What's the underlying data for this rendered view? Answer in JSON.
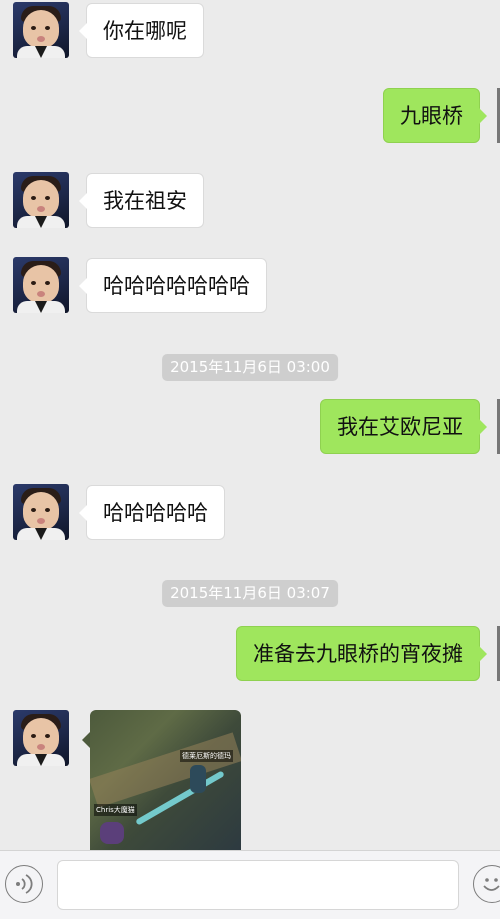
{
  "messages": [
    {
      "side": "in",
      "text": "你在哪呢"
    },
    {
      "side": "out",
      "text": "九眼桥"
    },
    {
      "side": "in",
      "text": "我在祖安"
    },
    {
      "side": "in",
      "text": "哈哈哈哈哈哈哈"
    },
    {
      "side": "time",
      "text": "2015年11月6日 03:00"
    },
    {
      "side": "out",
      "text": "我在艾欧尼亚"
    },
    {
      "side": "in",
      "text": "哈哈哈哈哈"
    },
    {
      "side": "time",
      "text": "2015年11月6日 03:07"
    },
    {
      "side": "out",
      "text": "准备去九眼桥的宵夜摊"
    },
    {
      "side": "in",
      "type": "image",
      "image_labels": [
        "德莱厄斯的德玛",
        "Chris大魔猫"
      ]
    }
  ],
  "input_bar": {
    "voice_icon": "voice-icon",
    "emoji_icon": "emoji-icon",
    "text_value": ""
  },
  "colors": {
    "background": "#ebebeb",
    "incoming_bubble": "#ffffff",
    "outgoing_bubble": "#9fe65d",
    "timestamp_pill": "#cecece"
  }
}
